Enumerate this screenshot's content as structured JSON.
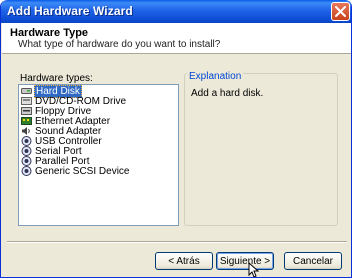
{
  "window": {
    "title": "Add Hardware Wizard"
  },
  "header": {
    "title": "Hardware Type",
    "subtitle": "What type of hardware do you want to install?"
  },
  "hardware_list": {
    "label": "Hardware types:",
    "items": [
      {
        "label": "Hard Disk",
        "icon": "hard-disk-icon",
        "selected": true
      },
      {
        "label": "DVD/CD-ROM Drive",
        "icon": "cdrom-icon",
        "selected": false
      },
      {
        "label": "Floppy Drive",
        "icon": "floppy-icon",
        "selected": false
      },
      {
        "label": "Ethernet Adapter",
        "icon": "network-card-icon",
        "selected": false
      },
      {
        "label": "Sound Adapter",
        "icon": "speaker-icon",
        "selected": false
      },
      {
        "label": "USB Controller",
        "icon": "usb-icon",
        "selected": false
      },
      {
        "label": "Serial Port",
        "icon": "port-icon",
        "selected": false
      },
      {
        "label": "Parallel Port",
        "icon": "port-icon",
        "selected": false
      },
      {
        "label": "Generic SCSI Device",
        "icon": "port-icon",
        "selected": false
      }
    ]
  },
  "explanation": {
    "label": "Explanation",
    "text": "Add a hard disk."
  },
  "buttons": {
    "back": "< Atrás",
    "next": "Siguiente >",
    "cancel": "Cancelar"
  },
  "colors": {
    "title_bar": "#0f4fd6",
    "selection": "#316ac5",
    "group_label": "#0046d5"
  }
}
